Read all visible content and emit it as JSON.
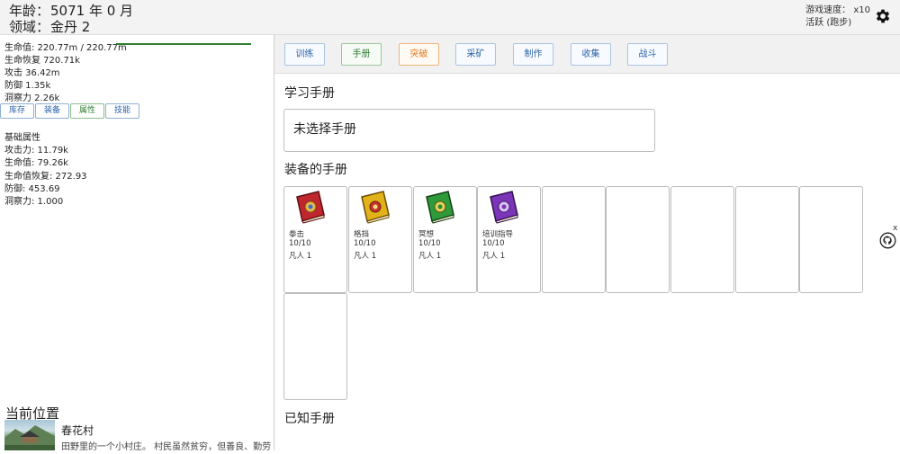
{
  "header": {
    "age_label": "年龄：",
    "age_value": "5071 年 0 月",
    "realm_label": "领域：",
    "realm_value": "金丹 2",
    "speed_text": "游戏速度： x10",
    "status_text": "活跃 (跑步)"
  },
  "stats": [
    {
      "label": "生命值: 220.77m / 220.77m"
    },
    {
      "label": "生命恢复 720.71k"
    },
    {
      "label": "攻击 36.42m"
    },
    {
      "label": "防御 1.35k"
    },
    {
      "label": "洞察力 2.26k"
    }
  ],
  "left_tabs": [
    {
      "label": "库存"
    },
    {
      "label": "装备"
    },
    {
      "label": "属性"
    },
    {
      "label": "技能"
    }
  ],
  "base_attributes": {
    "title": "基础属性",
    "items": [
      "攻击力: 11.79k",
      "生命值: 79.26k",
      "生命值恢复: 272.93",
      "防御: 453.69",
      "洞察力: 1.000"
    ]
  },
  "location": {
    "title": "当前位置",
    "name": "春花村",
    "desc": "田野里的一个小村庄。 村民虽然贫穷，但善良、勤劳"
  },
  "nav": [
    {
      "label": "训练",
      "style": "blue"
    },
    {
      "label": "手册",
      "style": "green"
    },
    {
      "label": "突破",
      "style": "orange"
    },
    {
      "label": "采矿",
      "style": "blue"
    },
    {
      "label": "制作",
      "style": "blue"
    },
    {
      "label": "收集",
      "style": "blue"
    },
    {
      "label": "战斗",
      "style": "blue"
    }
  ],
  "manual": {
    "learn_title": "学习手册",
    "selected": "未选择手册",
    "equipped_title": "装备的手册",
    "known_title": "已知手册"
  },
  "books": [
    {
      "name": "拳击",
      "level": "10/10",
      "rank": "凡人 1",
      "icon": "red-book-icon",
      "color": "#c0262d",
      "accent": "#e6b84a"
    },
    {
      "name": "格挡",
      "level": "10/10",
      "rank": "凡人 1",
      "icon": "yellow-book-icon",
      "color": "#e2b21a",
      "accent": "#c9332b"
    },
    {
      "name": "冥想",
      "level": "10/10",
      "rank": "凡人 1",
      "icon": "green-book-icon",
      "color": "#2f9a3a",
      "accent": "#e3d25a"
    },
    {
      "name": "培训指导",
      "level": "10/10",
      "rank": "凡人 1",
      "icon": "purple-book-icon",
      "color": "#7a35b8",
      "accent": "#d9c3f0"
    }
  ],
  "side": {
    "close": "x"
  },
  "icons": {
    "settings": "gear-icon",
    "side": "github-icon"
  }
}
